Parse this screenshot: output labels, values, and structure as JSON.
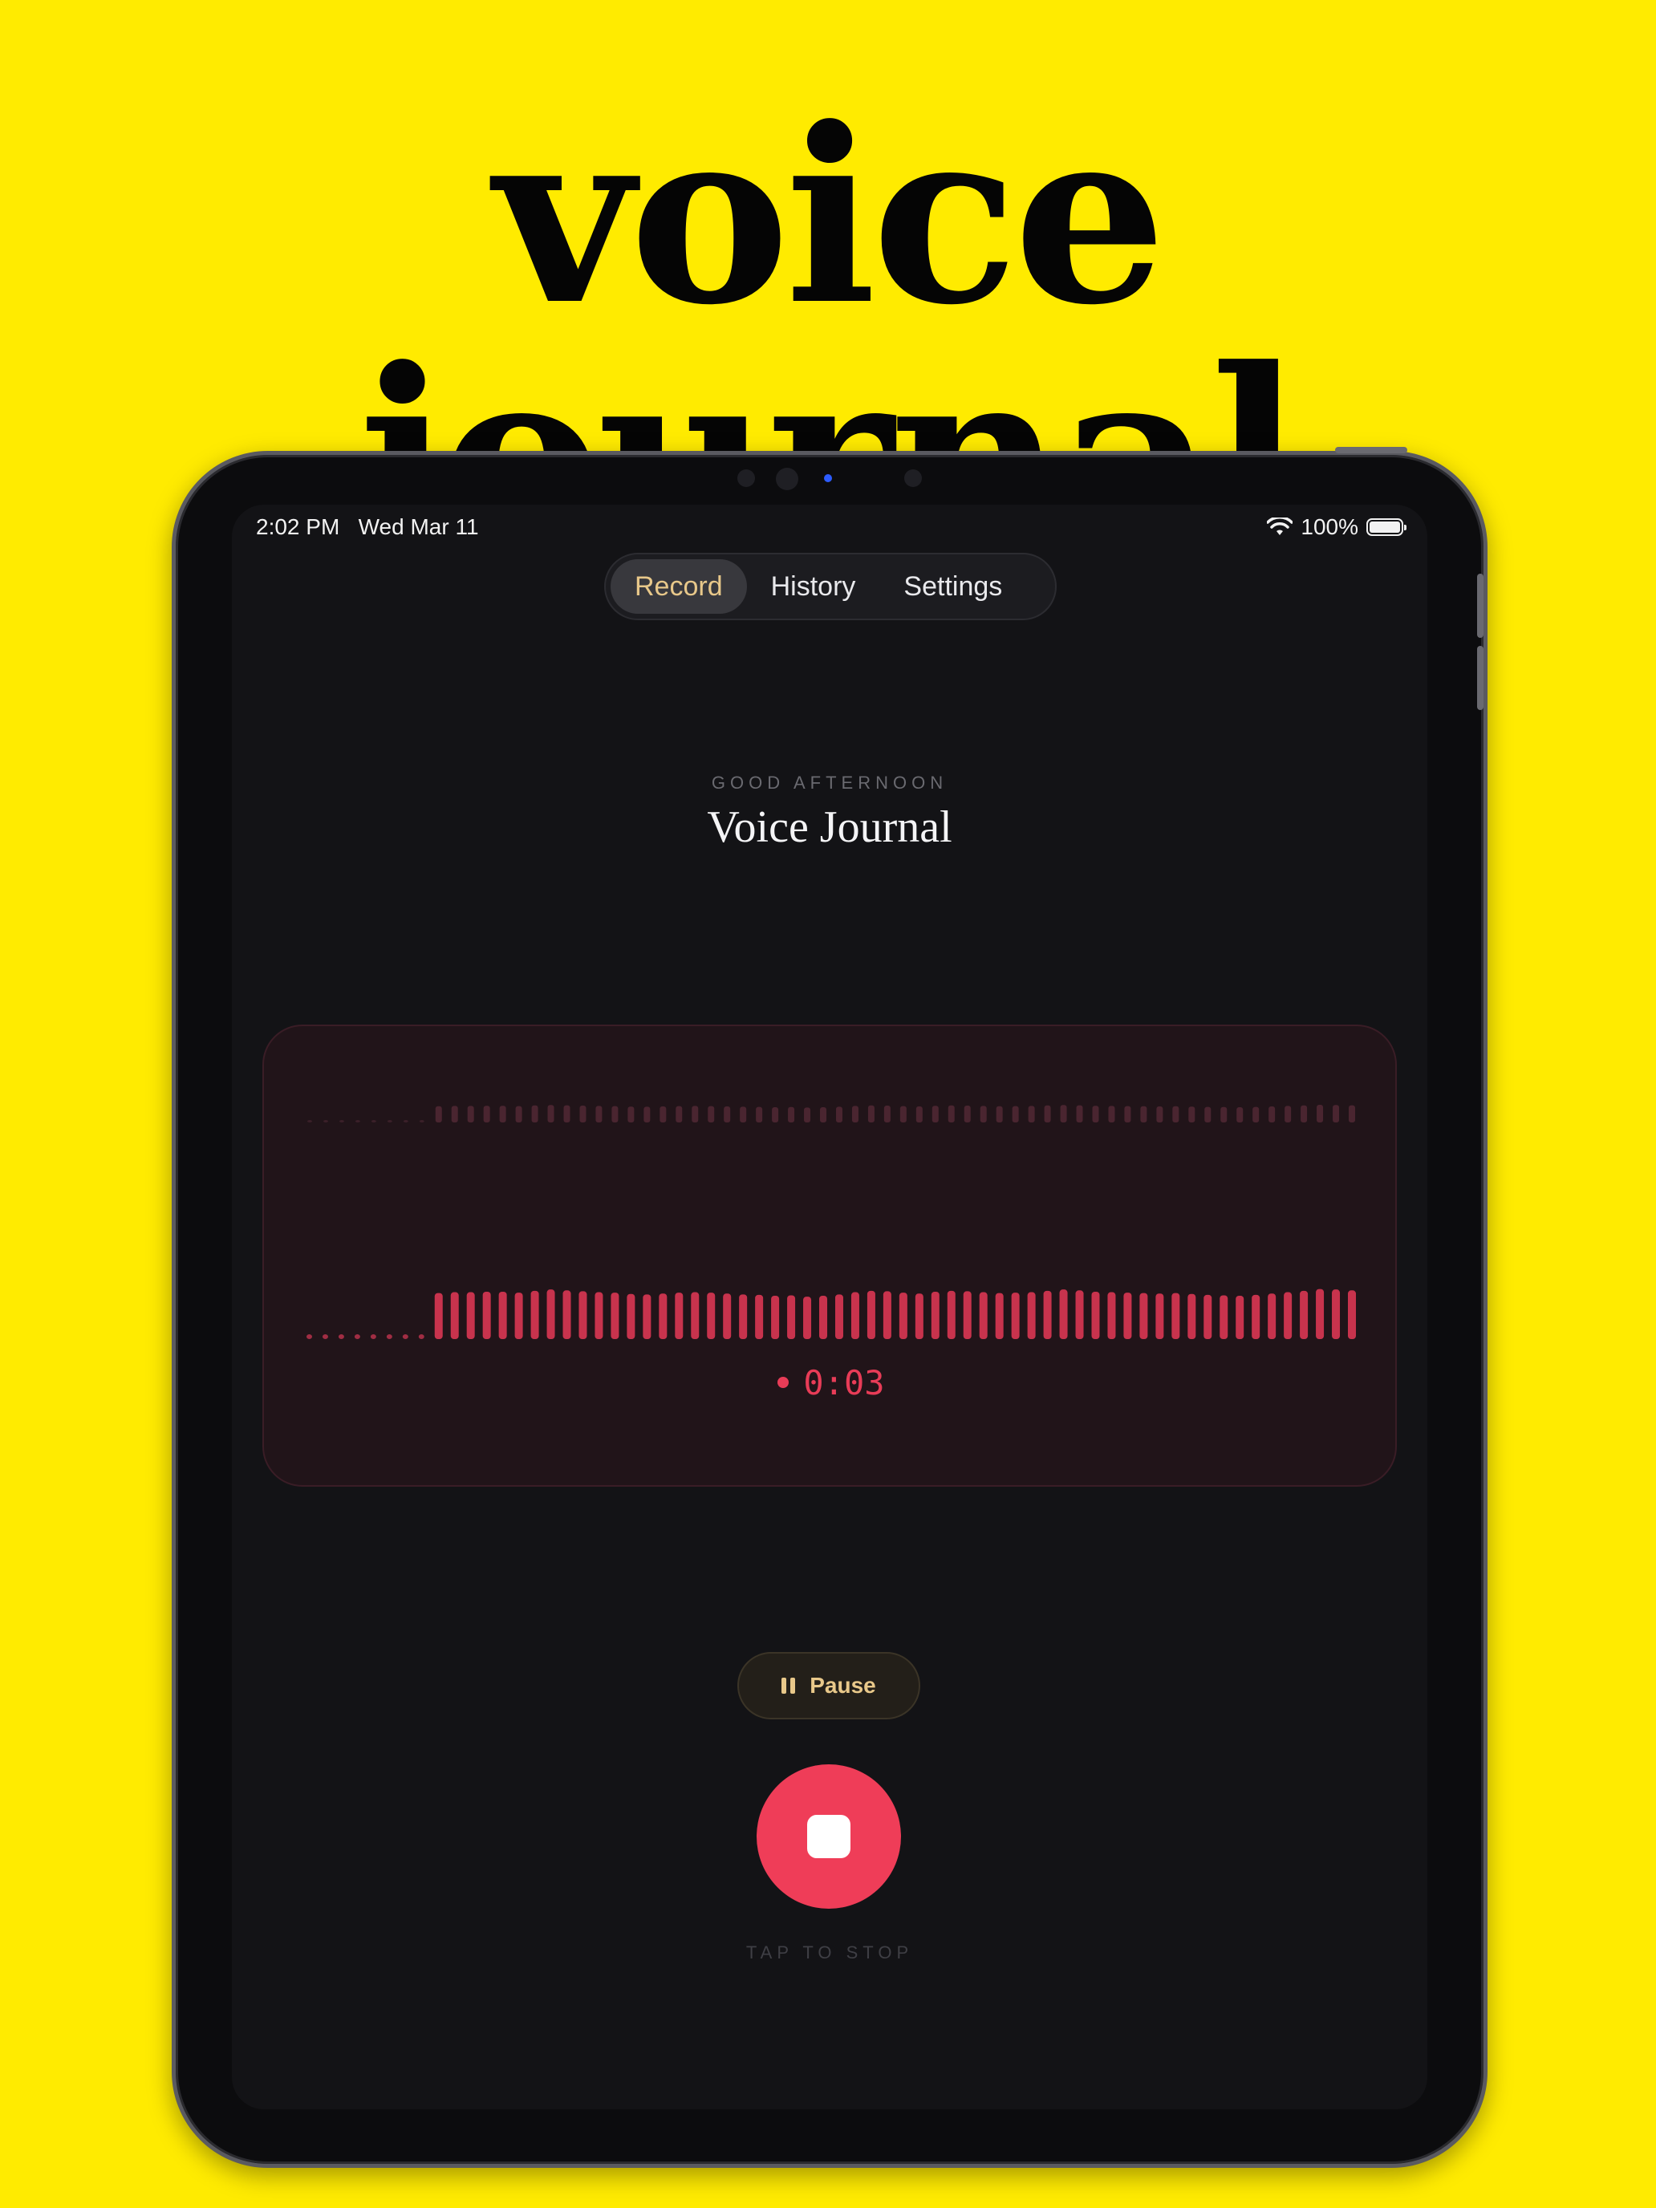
{
  "headline": "voice journal",
  "status_bar": {
    "time": "2:02 PM",
    "date": "Wed Mar 11",
    "battery": "100%",
    "battery_level": 1.0
  },
  "tabs": [
    {
      "label": "Record",
      "active": true
    },
    {
      "label": "History",
      "active": false
    },
    {
      "label": "Settings",
      "active": false
    }
  ],
  "greeting": {
    "eyebrow": "GOOD AFTERNOON",
    "title": "Voice Journal"
  },
  "recorder": {
    "timer": "0:03",
    "pause_label": "Pause",
    "hint": "TAP TO STOP",
    "quiet_bars": 8,
    "levels": [
      0.62,
      0.66,
      0.66,
      0.68,
      0.68,
      0.64,
      0.72,
      0.78,
      0.74,
      0.7,
      0.66,
      0.64,
      0.58,
      0.56,
      0.6,
      0.64,
      0.66,
      0.64,
      0.6,
      0.56,
      0.54,
      0.5,
      0.52,
      0.46,
      0.5,
      0.56,
      0.66,
      0.72,
      0.7,
      0.64,
      0.6,
      0.68,
      0.72,
      0.7,
      0.66,
      0.62,
      0.64,
      0.66,
      0.72,
      0.78,
      0.74,
      0.68,
      0.66,
      0.64,
      0.62,
      0.6,
      0.62,
      0.58,
      0.54,
      0.52,
      0.5,
      0.54,
      0.6,
      0.66,
      0.72,
      0.8,
      0.78,
      0.74
    ]
  },
  "colors": {
    "background": "#FFEB00",
    "accent_red": "#ef3d58",
    "accent_gold": "#e8c88a"
  },
  "icons": {
    "wifi": "wifi-icon",
    "battery": "battery-icon",
    "pause": "pause-icon",
    "stop": "stop-icon",
    "record_dot": "record-dot-icon"
  }
}
